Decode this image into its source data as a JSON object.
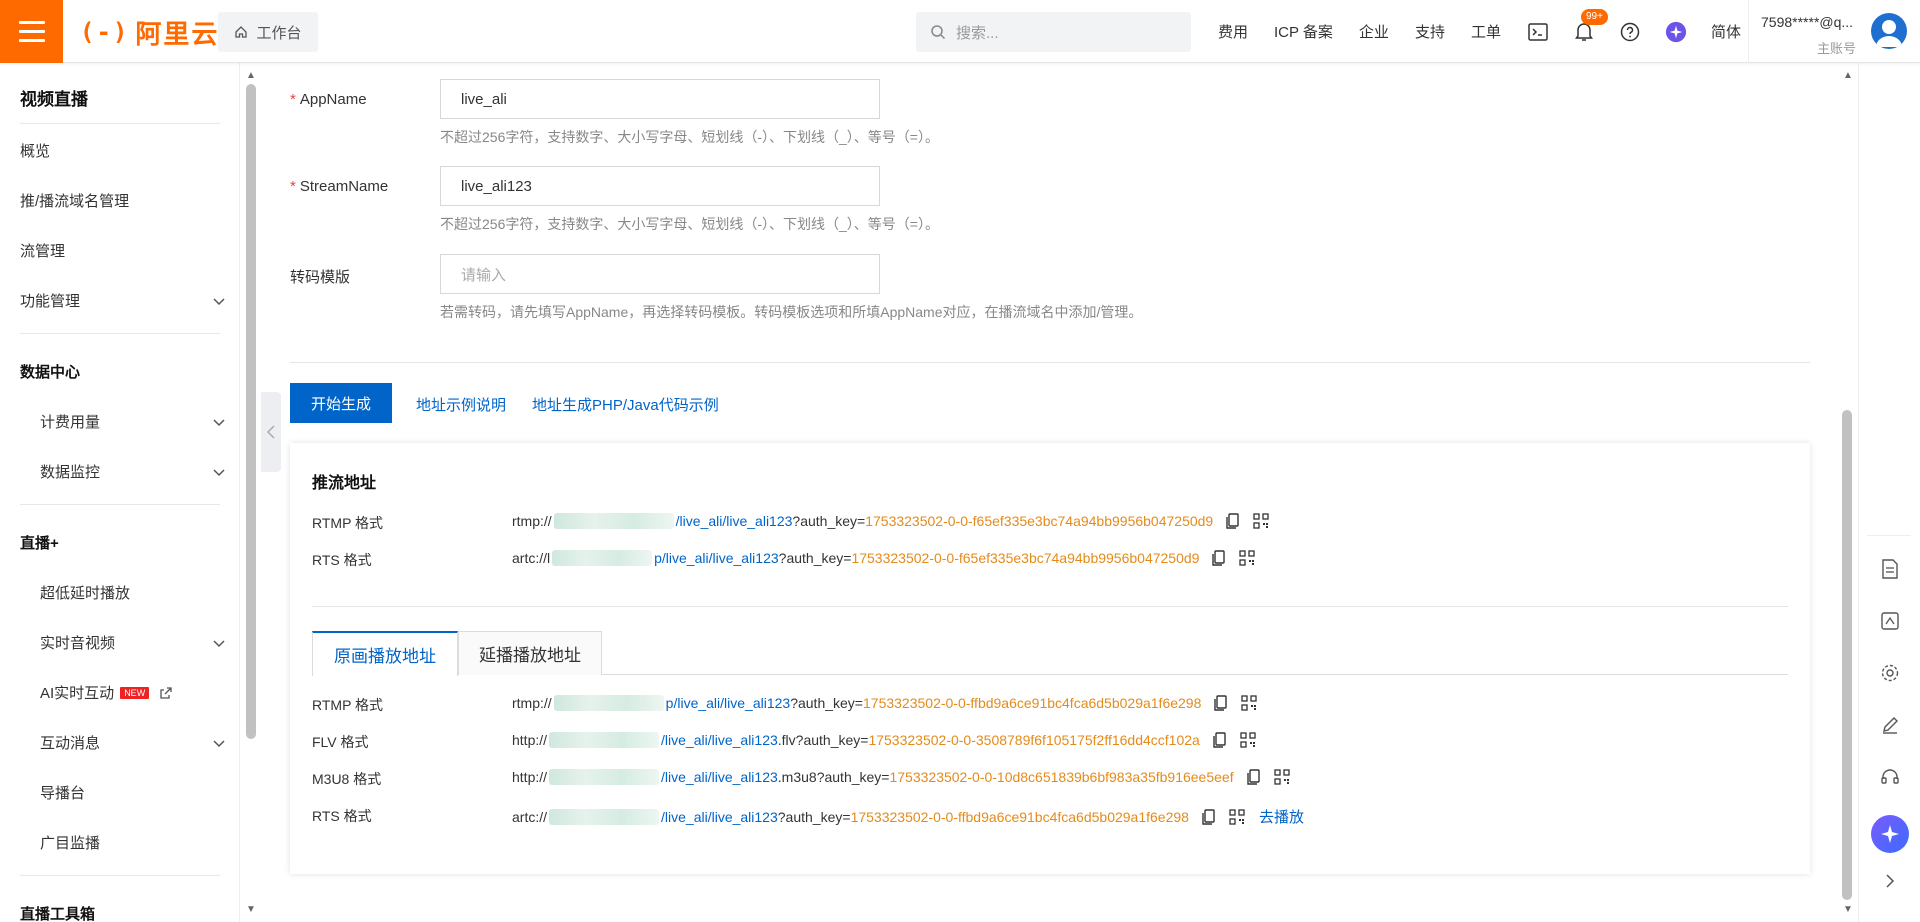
{
  "header": {
    "logo_text": "阿里云",
    "workbench_label": "工作台",
    "search_placeholder": "搜索...",
    "nav": [
      "费用",
      "ICP 备案",
      "企业",
      "支持",
      "工单"
    ],
    "notification_badge": "99+",
    "language": "简体",
    "account_name": "7598*****@q...",
    "account_type": "主账号"
  },
  "sidebar": {
    "title": "视频直播",
    "items": {
      "overview": "概览",
      "domain_mgmt": "推/播流域名管理",
      "stream_mgmt": "流管理",
      "feature_mgmt": "功能管理"
    },
    "data_center": {
      "title": "数据中心",
      "billing": "计费用量",
      "monitor": "数据监控"
    },
    "live_plus": {
      "title": "直播+",
      "low_latency": "超低延时播放",
      "rtc": "实时音视频",
      "ai_interact": "AI实时互动",
      "new_tag": "NEW",
      "interact_msg": "互动消息",
      "director": "导播台",
      "monitor": "广目监播"
    },
    "toolbox_title": "直播工具箱"
  },
  "form": {
    "app_name_label": "AppName",
    "app_name_value": "live_ali",
    "app_name_hint": "不超过256字符，支持数字、大小写字母、短划线（-）、下划线（_）、等号（=）。",
    "stream_name_label": "StreamName",
    "stream_name_value": "live_ali123",
    "stream_name_hint": "不超过256字符，支持数字、大小写字母、短划线（-）、下划线（_）、等号（=）。",
    "transcode_label": "转码模版",
    "transcode_placeholder": "请输入",
    "transcode_hint": "若需转码，请先填写AppName，再选择转码模板。转码模板选项和所填AppName对应，在播流域名中添加/管理。",
    "generate_button": "开始生成",
    "link_examples": "地址示例说明",
    "link_code": "地址生成PHP/Java代码示例"
  },
  "push": {
    "title": "推流地址",
    "rows": [
      {
        "label": "RTMP 格式",
        "prefix": "rtmp://",
        "tail": "/live_ali/live_ali123",
        "query": "?auth_key=",
        "key": "1753323502-0-0-f65ef335e3bc74a94bb9956b047250d9"
      },
      {
        "label": "RTS 格式",
        "prefix": "artc://l",
        "tail": "p/live_ali/live_ali123",
        "query": "?auth_key=",
        "key": "1753323502-0-0-f65ef335e3bc74a94bb9956b047250d9"
      }
    ]
  },
  "play": {
    "tabs": [
      "原画播放地址",
      "延播播放地址"
    ],
    "rows": [
      {
        "label": "RTMP 格式",
        "prefix": "rtmp://",
        "tail": "p/live_ali/live_ali123",
        "query": "?auth_key=",
        "key": "1753323502-0-0-ffbd9a6ce91bc4fca6d5b029a1f6e298"
      },
      {
        "label": "FLV 格式",
        "prefix": "http://",
        "tail": "/live_ali/live_ali123",
        "query": ".flv?auth_key=",
        "key": "1753323502-0-0-3508789f6f105175f2ff16dd4ccf102a"
      },
      {
        "label": "M3U8 格式",
        "prefix": "http://",
        "tail": "/live_ali/live_ali123",
        "query": ".m3u8?auth_key=",
        "key": "1753323502-0-0-10d8c651839b6bf983a35fb916ee5eef"
      },
      {
        "label": "RTS 格式",
        "prefix": "artc://",
        "tail": "/live_ali/live_ali123",
        "query": "?auth_key=",
        "key": "1753323502-0-0-ffbd9a6ce91bc4fca6d5b029a1f6e298"
      }
    ],
    "go_play": "去播放"
  },
  "colors": {
    "brand_orange": "#ff6a00",
    "primary_blue": "#0064c8",
    "auth_key_orange": "#e48b1c"
  }
}
